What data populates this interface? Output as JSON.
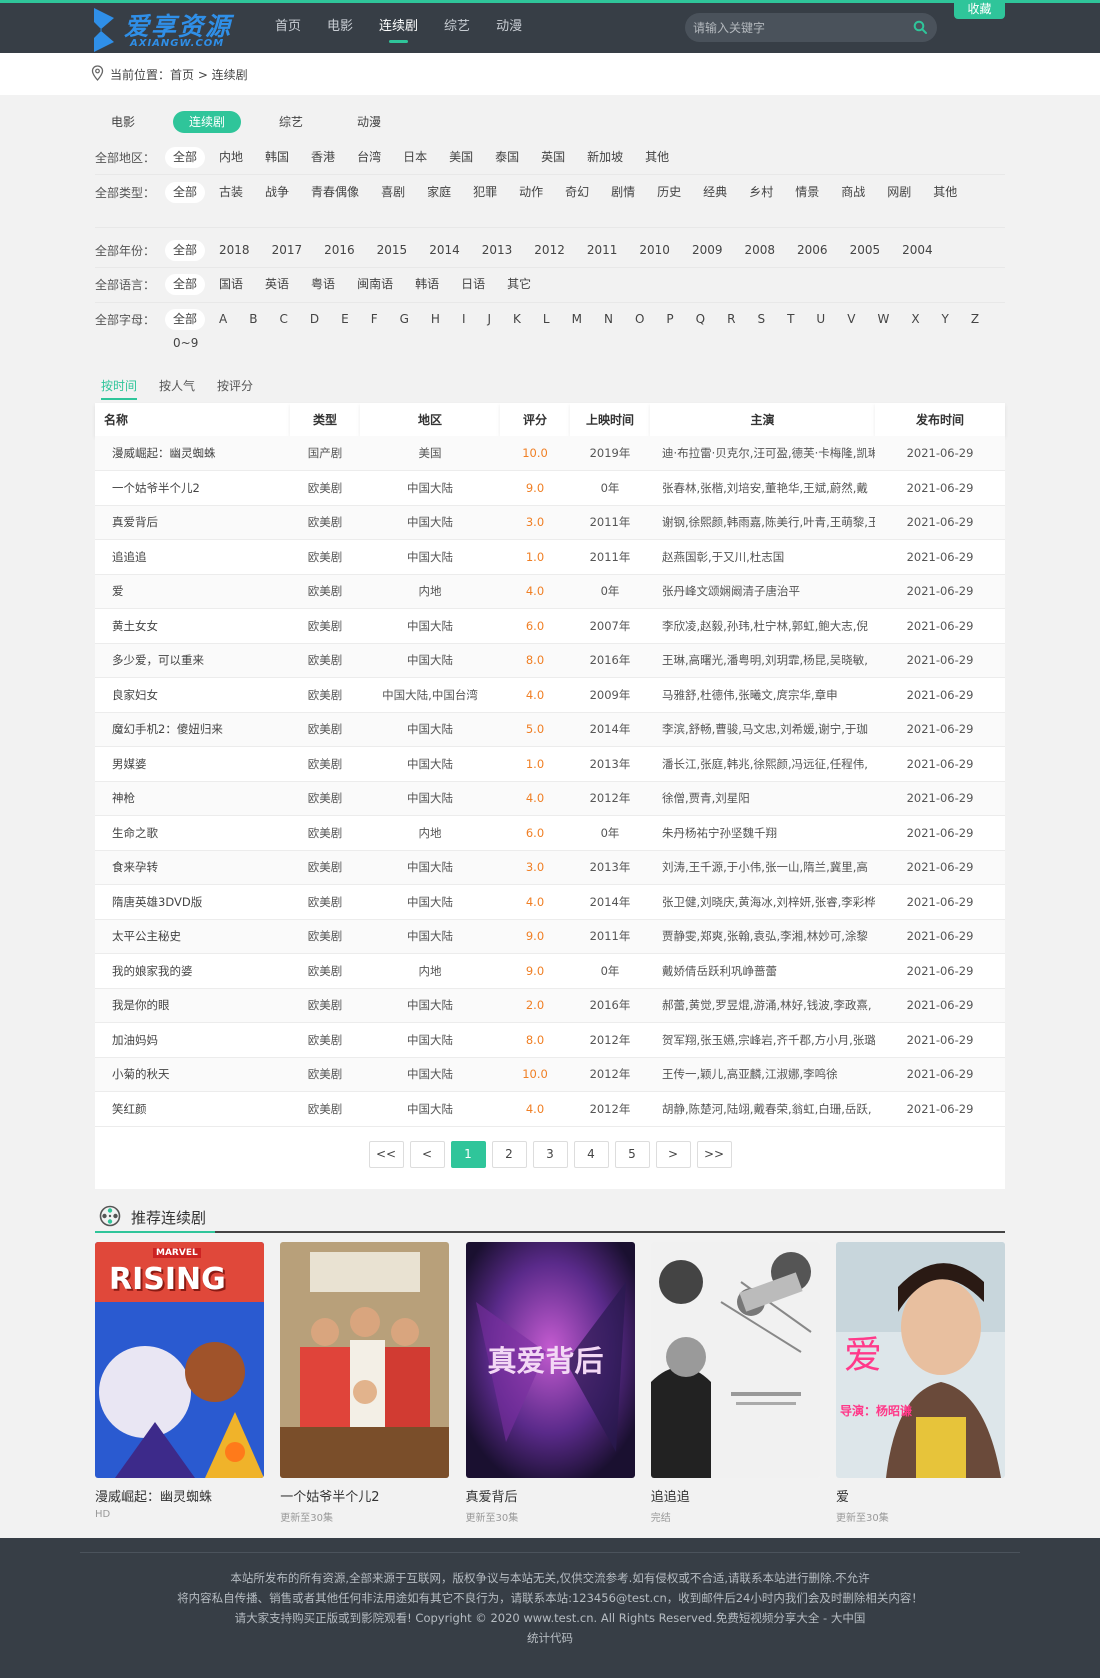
{
  "header": {
    "logo_text": "爱享资源",
    "logo_sub": "AXIANGW.COM",
    "nav": [
      "首页",
      "电影",
      "连续剧",
      "综艺",
      "动漫"
    ],
    "nav_active_index": 2,
    "search_placeholder": "请输入关键字",
    "fav_label": "收藏"
  },
  "breadcrumb": {
    "text": "当前位置：首页 > 连续剧"
  },
  "categories": {
    "items": [
      "电影",
      "连续剧",
      "综艺",
      "动漫"
    ],
    "active_index": 1
  },
  "filters": [
    {
      "label": "全部地区：",
      "options": [
        "全部",
        "内地",
        "韩国",
        "香港",
        "台湾",
        "日本",
        "美国",
        "泰国",
        "英国",
        "新加坡",
        "其他"
      ]
    },
    {
      "label": "全部类型：",
      "options": [
        "全部",
        "古装",
        "战争",
        "青春偶像",
        "喜剧",
        "家庭",
        "犯罪",
        "动作",
        "奇幻",
        "剧情",
        "历史",
        "经典",
        "乡村",
        "情景",
        "商战",
        "网剧",
        "其他"
      ]
    },
    {
      "label": "全部年份：",
      "options": [
        "全部",
        "2018",
        "2017",
        "2016",
        "2015",
        "2014",
        "2013",
        "2012",
        "2011",
        "2010",
        "2009",
        "2008",
        "2006",
        "2005",
        "2004"
      ]
    },
    {
      "label": "全部语言：",
      "options": [
        "全部",
        "国语",
        "英语",
        "粤语",
        "闽南语",
        "韩语",
        "日语",
        "其它"
      ]
    },
    {
      "label": "全部字母：",
      "options": [
        "全部",
        "A",
        "B",
        "C",
        "D",
        "E",
        "F",
        "G",
        "H",
        "I",
        "J",
        "K",
        "L",
        "M",
        "N",
        "O",
        "P",
        "Q",
        "R",
        "S",
        "T",
        "U",
        "V",
        "W",
        "X",
        "Y",
        "Z",
        "0~9"
      ]
    }
  ],
  "sort_tabs": {
    "items": [
      "按时间",
      "按人气",
      "按评分"
    ],
    "active_index": 0
  },
  "table": {
    "headers": [
      "名称",
      "类型",
      "地区",
      "评分",
      "上映时间",
      "主演",
      "发布时间"
    ],
    "rows": [
      [
        "漫威崛起：幽灵蜘蛛",
        "国产剧",
        "美国",
        "10.0",
        "2019年",
        "迪·布拉雷·贝克尔,汪可盈,德芙·卡梅隆,凯琳",
        "2021-06-29"
      ],
      [
        "一个姑爷半个儿2",
        "欧美剧",
        "中国大陆",
        "9.0",
        "0年",
        "张春林,张楷,刘培安,董艳华,王斌,蔚然,戴",
        "2021-06-29"
      ],
      [
        "真爱背后",
        "欧美剧",
        "中国大陆",
        "3.0",
        "2011年",
        "谢钢,徐熙颜,韩雨嘉,陈美行,叶青,王萌黎,王",
        "2021-06-29"
      ],
      [
        "追追追",
        "欧美剧",
        "中国大陆",
        "1.0",
        "2011年",
        "赵燕国彰,于又川,杜志国",
        "2021-06-29"
      ],
      [
        "爱",
        "欧美剧",
        "内地",
        "4.0",
        "0年",
        "张丹峰文颂娴阚清子唐治平",
        "2021-06-29"
      ],
      [
        "黄土女女",
        "欧美剧",
        "中国大陆",
        "6.0",
        "2007年",
        "李欣凌,赵毅,孙玮,杜宁林,郭虹,鲍大志,倪",
        "2021-06-29"
      ],
      [
        "多少爱，可以重来",
        "欧美剧",
        "中国大陆",
        "8.0",
        "2016年",
        "王琳,高曙光,潘粤明,刘玥霏,杨昆,吴晓敏,",
        "2021-06-29"
      ],
      [
        "良家妇女",
        "欧美剧",
        "中国大陆,中国台湾",
        "4.0",
        "2009年",
        "马雅舒,杜德伟,张曦文,庹宗华,章申",
        "2021-06-29"
      ],
      [
        "魔幻手机2：傻妞归来",
        "欧美剧",
        "中国大陆",
        "5.0",
        "2014年",
        "李滨,舒畅,曹骏,马文忠,刘希媛,谢宁,于珈",
        "2021-06-29"
      ],
      [
        "男媒婆",
        "欧美剧",
        "中国大陆",
        "1.0",
        "2013年",
        "潘长江,张庭,韩兆,徐熙颜,冯远征,任程伟,",
        "2021-06-29"
      ],
      [
        "神枪",
        "欧美剧",
        "中国大陆",
        "4.0",
        "2012年",
        "徐僧,贾青,刘星阳",
        "2021-06-29"
      ],
      [
        "生命之歌",
        "欧美剧",
        "内地",
        "6.0",
        "0年",
        "朱丹杨祐宁孙坚魏千翔",
        "2021-06-29"
      ],
      [
        "食来孕转",
        "欧美剧",
        "中国大陆",
        "3.0",
        "2013年",
        "刘涛,王千源,于小伟,张一山,隋兰,冀里,高",
        "2021-06-29"
      ],
      [
        "隋唐英雄3DVD版",
        "欧美剧",
        "中国大陆",
        "4.0",
        "2014年",
        "张卫健,刘晓庆,黄海冰,刘梓妍,张睿,李彩桦",
        "2021-06-29"
      ],
      [
        "太平公主秘史",
        "欧美剧",
        "中国大陆",
        "9.0",
        "2011年",
        "贾静雯,郑爽,张翰,袁弘,李湘,林妙可,涂黎",
        "2021-06-29"
      ],
      [
        "我的娘家我的婆",
        "欧美剧",
        "内地",
        "9.0",
        "0年",
        "戴娇倩岳跃利巩峥蔷蕾",
        "2021-06-29"
      ],
      [
        "我是你的眼",
        "欧美剧",
        "中国大陆",
        "2.0",
        "2016年",
        "郝蕾,黄觉,罗昱焜,游涌,林好,钱波,李政熹,",
        "2021-06-29"
      ],
      [
        "加油妈妈",
        "欧美剧",
        "中国大陆",
        "8.0",
        "2012年",
        "贺军翔,张玉嬿,宗峰岩,齐千郡,方小月,张璐",
        "2021-06-29"
      ],
      [
        "小菊的秋天",
        "欧美剧",
        "中国大陆",
        "10.0",
        "2012年",
        "王传一,颖儿,高亚麟,江淑娜,李鸣徐",
        "2021-06-29"
      ],
      [
        "笑红颜",
        "欧美剧",
        "中国大陆",
        "4.0",
        "2012年",
        "胡静,陈楚河,陆翊,戴春荣,翁虹,白珊,岳跃,",
        "2021-06-29"
      ]
    ]
  },
  "pagination": {
    "items": [
      "<<",
      "<",
      "1",
      "2",
      "3",
      "4",
      "5",
      ">",
      ">>"
    ],
    "active_index": 2
  },
  "recommend": {
    "title": "推荐连续剧",
    "cards": [
      {
        "title": "漫威崛起：幽灵蜘蛛",
        "sub": "HD",
        "poster_text": "RISING",
        "poster_sub": "MARVEL"
      },
      {
        "title": "一个姑爷半个儿2",
        "sub": "更新至30集"
      },
      {
        "title": "真爱背后",
        "sub": "更新至30集",
        "poster_text": "真爱背后"
      },
      {
        "title": "追追追",
        "sub": "完结"
      },
      {
        "title": "爱",
        "sub": "更新至30集",
        "poster_text": "爱",
        "poster_sub": "导演：杨昭谦"
      }
    ]
  },
  "footer": {
    "lines": [
      "本站所发布的所有资源,全部来源于互联网，版权争议与本站无关,仅供交流参考.如有侵权或不合适,请联系本站进行删除.不允许",
      "将内容私自传播、销售或者其他任何非法用途如有其它不良行为，请联系本站:123456@test.cn，收到邮件后24小时内我们会及时删除相关内容！",
      "请大家支持购买正版或到影院观看! Copyright © 2020 www.test.cn. All Rights Reserved.免费短视频分享大全 - 大中国",
      "统计代码"
    ]
  },
  "colors": {
    "accent": "#2fc59a",
    "header_bg": "#373e46",
    "score": "#f07f24"
  }
}
